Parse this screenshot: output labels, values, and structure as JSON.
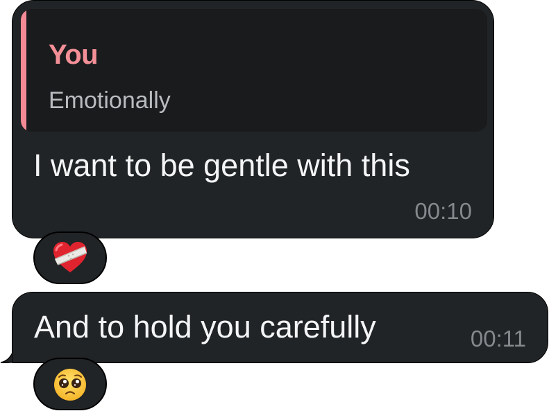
{
  "messages": [
    {
      "reply": {
        "author": "You",
        "text": "Emotionally",
        "accent_color": "#f28b95"
      },
      "text": "I want to be gentle with this",
      "time": "00:10",
      "reaction": {
        "icon": "mending-heart-icon"
      }
    },
    {
      "text": "And to hold you carefully",
      "time": "00:11",
      "reaction": {
        "icon": "pleading-face-icon"
      }
    }
  ],
  "colors": {
    "bubble": "#212426",
    "quote_bg": "#1a1b1d",
    "text": "#f4f5f6",
    "time": "#85898d",
    "reply_author": "#f38f97"
  }
}
